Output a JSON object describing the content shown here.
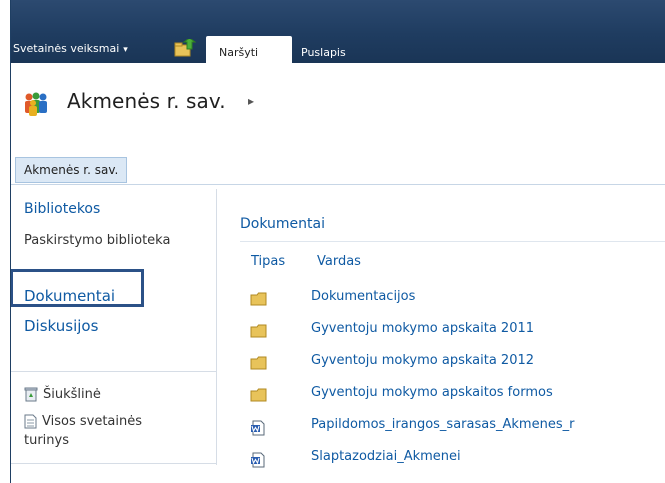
{
  "ribbon": {
    "site_actions_label": "Svetainės veiksmai",
    "site_actions_caret": "▾",
    "tabs": [
      {
        "label": "Naršyti",
        "selected": true
      },
      {
        "label": "Puslapis",
        "selected": false
      }
    ]
  },
  "site": {
    "title": "Akmenės r. sav.",
    "breadcrumb_arrow": "▸"
  },
  "topnav": {
    "items": [
      {
        "label": "Akmenės r. sav.",
        "selected": true
      }
    ]
  },
  "leftnav": {
    "libraries_heading": "Bibliotekos",
    "libraries_sub": "Paskirstymo biblioteka",
    "links": [
      {
        "label": "Dokumentai",
        "highlighted": true
      },
      {
        "label": "Diskusijos",
        "highlighted": false
      }
    ],
    "footer": {
      "recycle_bin": "Šiukšlinė",
      "all_content_line1": "Visos svetainės",
      "all_content_line2": "turinys"
    }
  },
  "main": {
    "webpart_title": "Dokumentai",
    "columns": {
      "type": "Tipas",
      "name": "Vardas"
    },
    "rows": [
      {
        "type": "folder-icon",
        "name": "Dokumentacijos"
      },
      {
        "type": "folder-icon",
        "name": "Gyventoju mokymo apskaita 2011"
      },
      {
        "type": "folder-icon",
        "name": "Gyventoju mokymo apskaita 2012"
      },
      {
        "type": "folder-icon",
        "name": "Gyventoju mokymo apskaitos formos"
      },
      {
        "type": "word-doc-icon",
        "name": "Papildomos_irangos_sarasas_Akmenes_r"
      },
      {
        "type": "word-doc-icon",
        "name": "Slaptazodziai_Akmenei"
      }
    ]
  },
  "colors": {
    "ribbon": "#1f3c60",
    "link": "#0f5aa3",
    "highlight_border": "#2b5187",
    "folder": "#e8c35a"
  }
}
